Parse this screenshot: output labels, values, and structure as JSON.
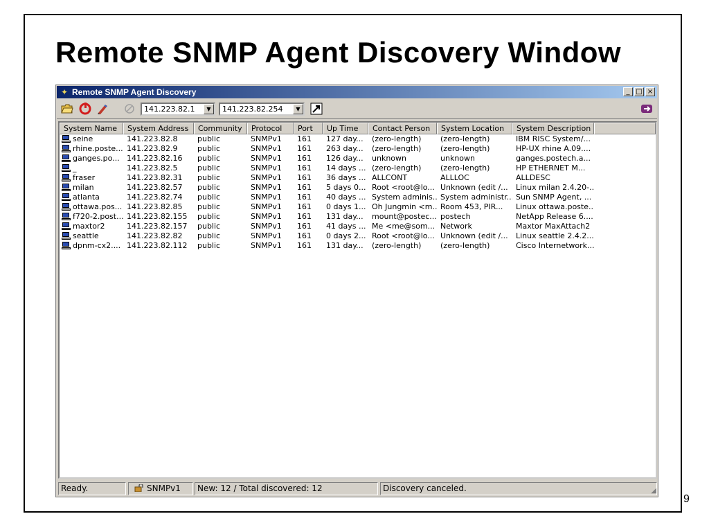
{
  "slide": {
    "title": "Remote SNMP Agent Discovery Window",
    "page_number": "9"
  },
  "window": {
    "title": "Remote SNMP Agent Discovery",
    "controls": {
      "minimize": "_",
      "maximize": "□",
      "close": "×"
    }
  },
  "toolbar": {
    "start_ip": "141.223.82.1",
    "end_ip": "141.223.82.254",
    "icons": [
      "open-folder-icon",
      "refresh-icon",
      "edit-pen-icon",
      "stop-icon",
      "discover-icon",
      "exit-icon"
    ]
  },
  "table": {
    "columns": [
      "System Name",
      "System Address",
      "Community",
      "Protocol",
      "Port",
      "Up Time",
      "Contact Person",
      "System Location",
      "System Description",
      ""
    ],
    "rows": [
      [
        "seine",
        "141.223.82.8",
        "public",
        "SNMPv1",
        "161",
        "127 day...",
        "(zero-length)",
        "(zero-length)",
        "IBM RISC System/..."
      ],
      [
        "rhine.poste...",
        "141.223.82.9",
        "public",
        "SNMPv1",
        "161",
        "263 day...",
        "(zero-length)",
        "(zero-length)",
        "HP-UX rhine A.09...."
      ],
      [
        "ganges.po...",
        "141.223.82.16",
        "public",
        "SNMPv1",
        "161",
        "126 day...",
        "unknown",
        "unknown",
        "ganges.postech.a..."
      ],
      [
        "_",
        "141.223.82.5",
        "public",
        "SNMPv1",
        "161",
        "14 days ...",
        "(zero-length)",
        "(zero-length)",
        "HP ETHERNET M..."
      ],
      [
        "fraser",
        "141.223.82.31",
        "public",
        "SNMPv1",
        "161",
        "36 days ...",
        "ALLCONT",
        "ALLLOC",
        "ALLDESC"
      ],
      [
        "milan",
        "141.223.82.57",
        "public",
        "SNMPv1",
        "161",
        "5 days 0...",
        "Root <root@lo...",
        "Unknown (edit /...",
        "Linux milan 2.4.20-..."
      ],
      [
        "atlanta",
        "141.223.82.74",
        "public",
        "SNMPv1",
        "161",
        "40 days ...",
        "System adminis...",
        "System administr...",
        "Sun SNMP Agent, ..."
      ],
      [
        "ottawa.pos...",
        "141.223.82.85",
        "public",
        "SNMPv1",
        "161",
        "0 days 1...",
        "Oh Jungmin <m...",
        "Room 453, PIR...",
        "Linux ottawa.poste..."
      ],
      [
        "f720-2.post...",
        "141.223.82.155",
        "public",
        "SNMPv1",
        "161",
        "131 day...",
        "mount@postec...",
        "postech",
        "NetApp Release 6...."
      ],
      [
        "maxtor2",
        "141.223.82.157",
        "public",
        "SNMPv1",
        "161",
        "41 days ...",
        "Me <me@som...",
        "Network",
        "Maxtor MaxAttach2"
      ],
      [
        "seattle",
        "141.223.82.82",
        "public",
        "SNMPv1",
        "161",
        "0 days 2...",
        "Root <root@lo...",
        "Unknown (edit /...",
        "Linux seattle 2.4.2..."
      ],
      [
        "dpnm-cx2....",
        "141.223.82.112",
        "public",
        "SNMPv1",
        "161",
        "131 day...",
        "(zero-length)",
        "(zero-length)",
        "Cisco Internetwork..."
      ]
    ]
  },
  "status": {
    "ready": "Ready.",
    "protocol": "SNMPv1",
    "counts": "New: 12 /  Total discovered: 12",
    "message": "Discovery canceled."
  }
}
